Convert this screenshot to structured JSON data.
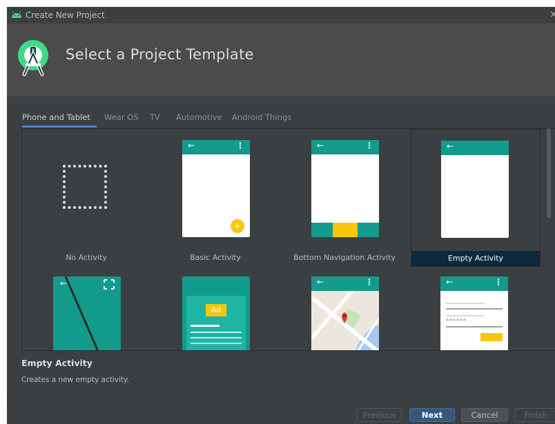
{
  "window": {
    "title": "Create New Project",
    "close_glyph": "×"
  },
  "header": {
    "title": "Select a Project Template",
    "logo_icon": "android-studio-icon"
  },
  "tabs": [
    {
      "label": "Phone and Tablet",
      "active": true
    },
    {
      "label": "Wear OS",
      "active": false
    },
    {
      "label": "TV",
      "active": false
    },
    {
      "label": "Automotive",
      "active": false
    },
    {
      "label": "Android Things",
      "active": false
    }
  ],
  "templates": [
    {
      "label": "No Activity",
      "selected": false
    },
    {
      "label": "Basic Activity",
      "selected": false
    },
    {
      "label": "Bottom Navigation Activity",
      "selected": false
    },
    {
      "label": "Empty Activity",
      "selected": true
    },
    {
      "label": "",
      "selected": false
    },
    {
      "label": "",
      "selected": false,
      "ad_text": "Ad"
    },
    {
      "label": "",
      "selected": false
    },
    {
      "label": "",
      "selected": false,
      "password_mask": "******"
    }
  ],
  "description": {
    "title": "Empty Activity",
    "text": "Creates a new empty activity."
  },
  "buttons": {
    "previous": "Previous",
    "next": "Next",
    "cancel": "Cancel",
    "finish": "Finish"
  },
  "colors": {
    "accent": "#129b8c",
    "fab": "#f7c70f",
    "selection": "#0d293e",
    "primary_button": "#365880",
    "tab_underline": "#4a88c7"
  },
  "glyphs": {
    "back_arrow": "←",
    "overflow": "⋮",
    "plus": "+"
  }
}
